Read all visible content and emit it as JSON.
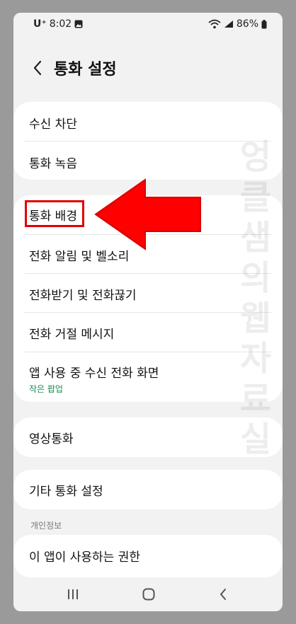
{
  "status_bar": {
    "carrier": "U⁺",
    "time": "8:02",
    "battery": "86%"
  },
  "header": {
    "title": "통화 설정"
  },
  "group1": {
    "items": [
      {
        "label": "수신 차단"
      },
      {
        "label": "통화 녹음"
      }
    ]
  },
  "group2": {
    "items": [
      {
        "label": "통화 배경"
      },
      {
        "label": "전화 알림 및 벨소리"
      },
      {
        "label": "전화받기 및 전화끊기"
      },
      {
        "label": "전화 거절 메시지"
      },
      {
        "label": "앱 사용 중 수신 전화 화면",
        "sub": "작은 팝업"
      }
    ]
  },
  "group3": {
    "items": [
      {
        "label": "영상통화"
      }
    ]
  },
  "group4": {
    "items": [
      {
        "label": "기타 통화 설정"
      }
    ]
  },
  "privacy": {
    "section_label": "개인정보",
    "items": [
      {
        "label": "이 앱이 사용하는 권한"
      }
    ]
  },
  "watermark": "엉클샘의웹자료실",
  "colors": {
    "highlight": "#e00000",
    "arrow": "#ff0000",
    "sub_text": "#1a8a52"
  }
}
